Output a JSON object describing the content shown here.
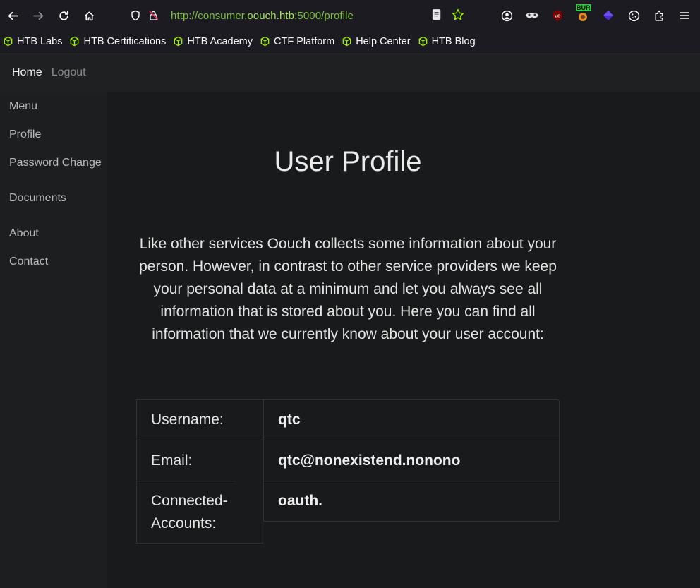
{
  "browser": {
    "url_prefix": "http://consumer.",
    "url_host": "oouch.htb",
    "url_suffix": ":5000/profile",
    "extensions": [
      "account-icon",
      "eye-mask-icon",
      "ublock-icon",
      "burp-icon",
      "diamond-icon",
      "cookie-icon",
      "puzzle-icon",
      "menu-icon"
    ],
    "burp_badge": "BUR"
  },
  "bookmarks": [
    {
      "label": "HTB Labs"
    },
    {
      "label": "HTB Certifications"
    },
    {
      "label": "HTB Academy"
    },
    {
      "label": "CTF Platform"
    },
    {
      "label": "Help Center"
    },
    {
      "label": "HTB Blog"
    }
  ],
  "topnav": {
    "home": "Home",
    "logout": "Logout"
  },
  "sidebar": {
    "items": [
      {
        "label": "Menu"
      },
      {
        "label": "Profile"
      },
      {
        "label": "Password Change"
      },
      {
        "label": "Documents"
      },
      {
        "label": "About"
      },
      {
        "label": "Contact"
      }
    ]
  },
  "main": {
    "title": "User Profile",
    "intro": "Like other services Oouch collects some information about your person. However, in contrast to other service providers we keep your personal data at a minimum and let you always see all information that is stored about you. Here you can find all information that we currently know about your user account:",
    "profile": [
      {
        "label": "Username:",
        "value": "qtc"
      },
      {
        "label": "Email:",
        "value": "qtc@nonexistend.nonono"
      },
      {
        "label": "Connected-Accounts:",
        "value": "oauth."
      }
    ]
  },
  "colors": {
    "accent_green": "#a4e35a",
    "bookmark_icon": "#9fef00"
  }
}
